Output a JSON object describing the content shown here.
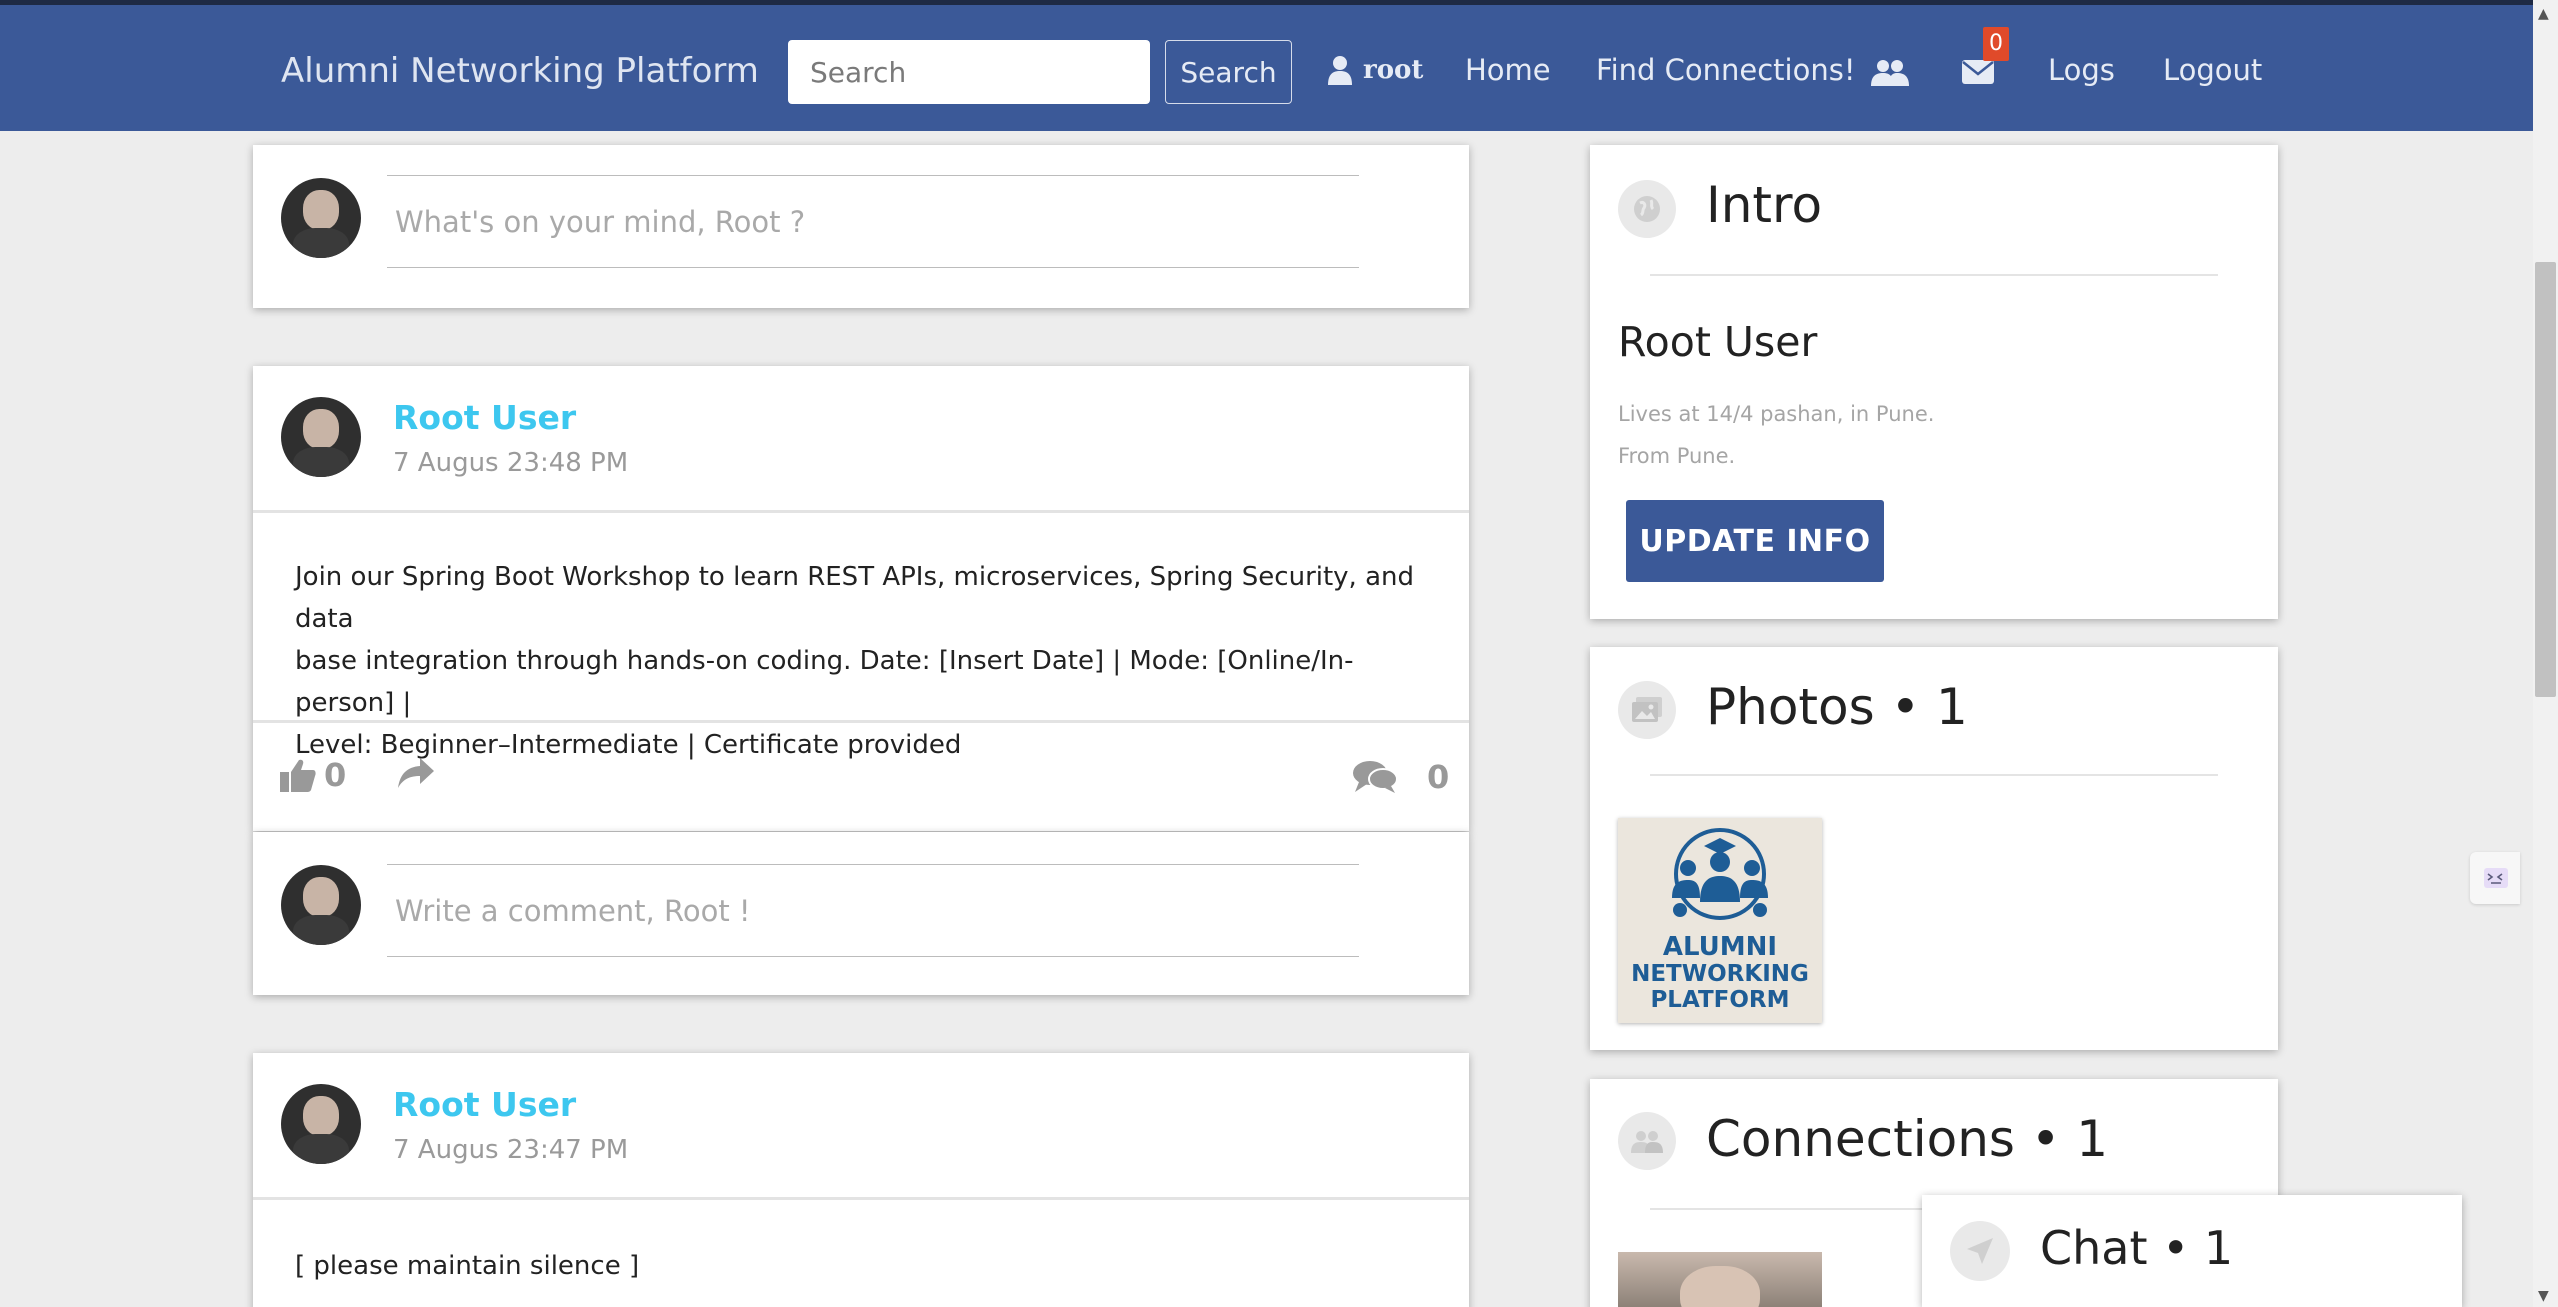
{
  "navbar": {
    "brand": "Alumni Networking Platform",
    "search_placeholder": "Search",
    "search_button": "Search",
    "user": "root",
    "home": "Home",
    "find_connections": "Find Connections!",
    "notification_count": "0",
    "logs": "Logs",
    "logout": "Logout"
  },
  "composer": {
    "placeholder": "What's on your mind, Root ?"
  },
  "posts": [
    {
      "author": "Root User",
      "time": "7 Augus 23:48 PM",
      "body_lines": [
        "Join our Spring Boot Workshop to learn REST APIs, microservices, Spring Security, and data",
        "base integration through hands-on coding. Date: [Insert Date] | Mode: [Online/In-person] |",
        "Level: Beginner–Intermediate | Certificate provided"
      ],
      "likes": "0",
      "comments": "0",
      "comment_placeholder": "Write a comment, Root !"
    },
    {
      "author": "Root User",
      "time": "7 Augus 23:47 PM",
      "body_lines": [
        "[ please maintain silence ]"
      ]
    }
  ],
  "intro": {
    "title": "Intro",
    "name": "Root User",
    "lives": "Lives at 14/4 pashan, in Pune.",
    "from": "From Pune.",
    "button": "UPDATE INFO"
  },
  "photos": {
    "title": "Photos • 1",
    "logo_line1": "ALUMNI",
    "logo_line2": "NETWORKING",
    "logo_line3": "PLATFORM"
  },
  "connections": {
    "title": "Connections • 1"
  },
  "chat": {
    "title": "Chat • 1"
  },
  "colors": {
    "navbar": "#3b5998",
    "author_link": "#3dc7ef",
    "badge": "#e04a2a"
  }
}
